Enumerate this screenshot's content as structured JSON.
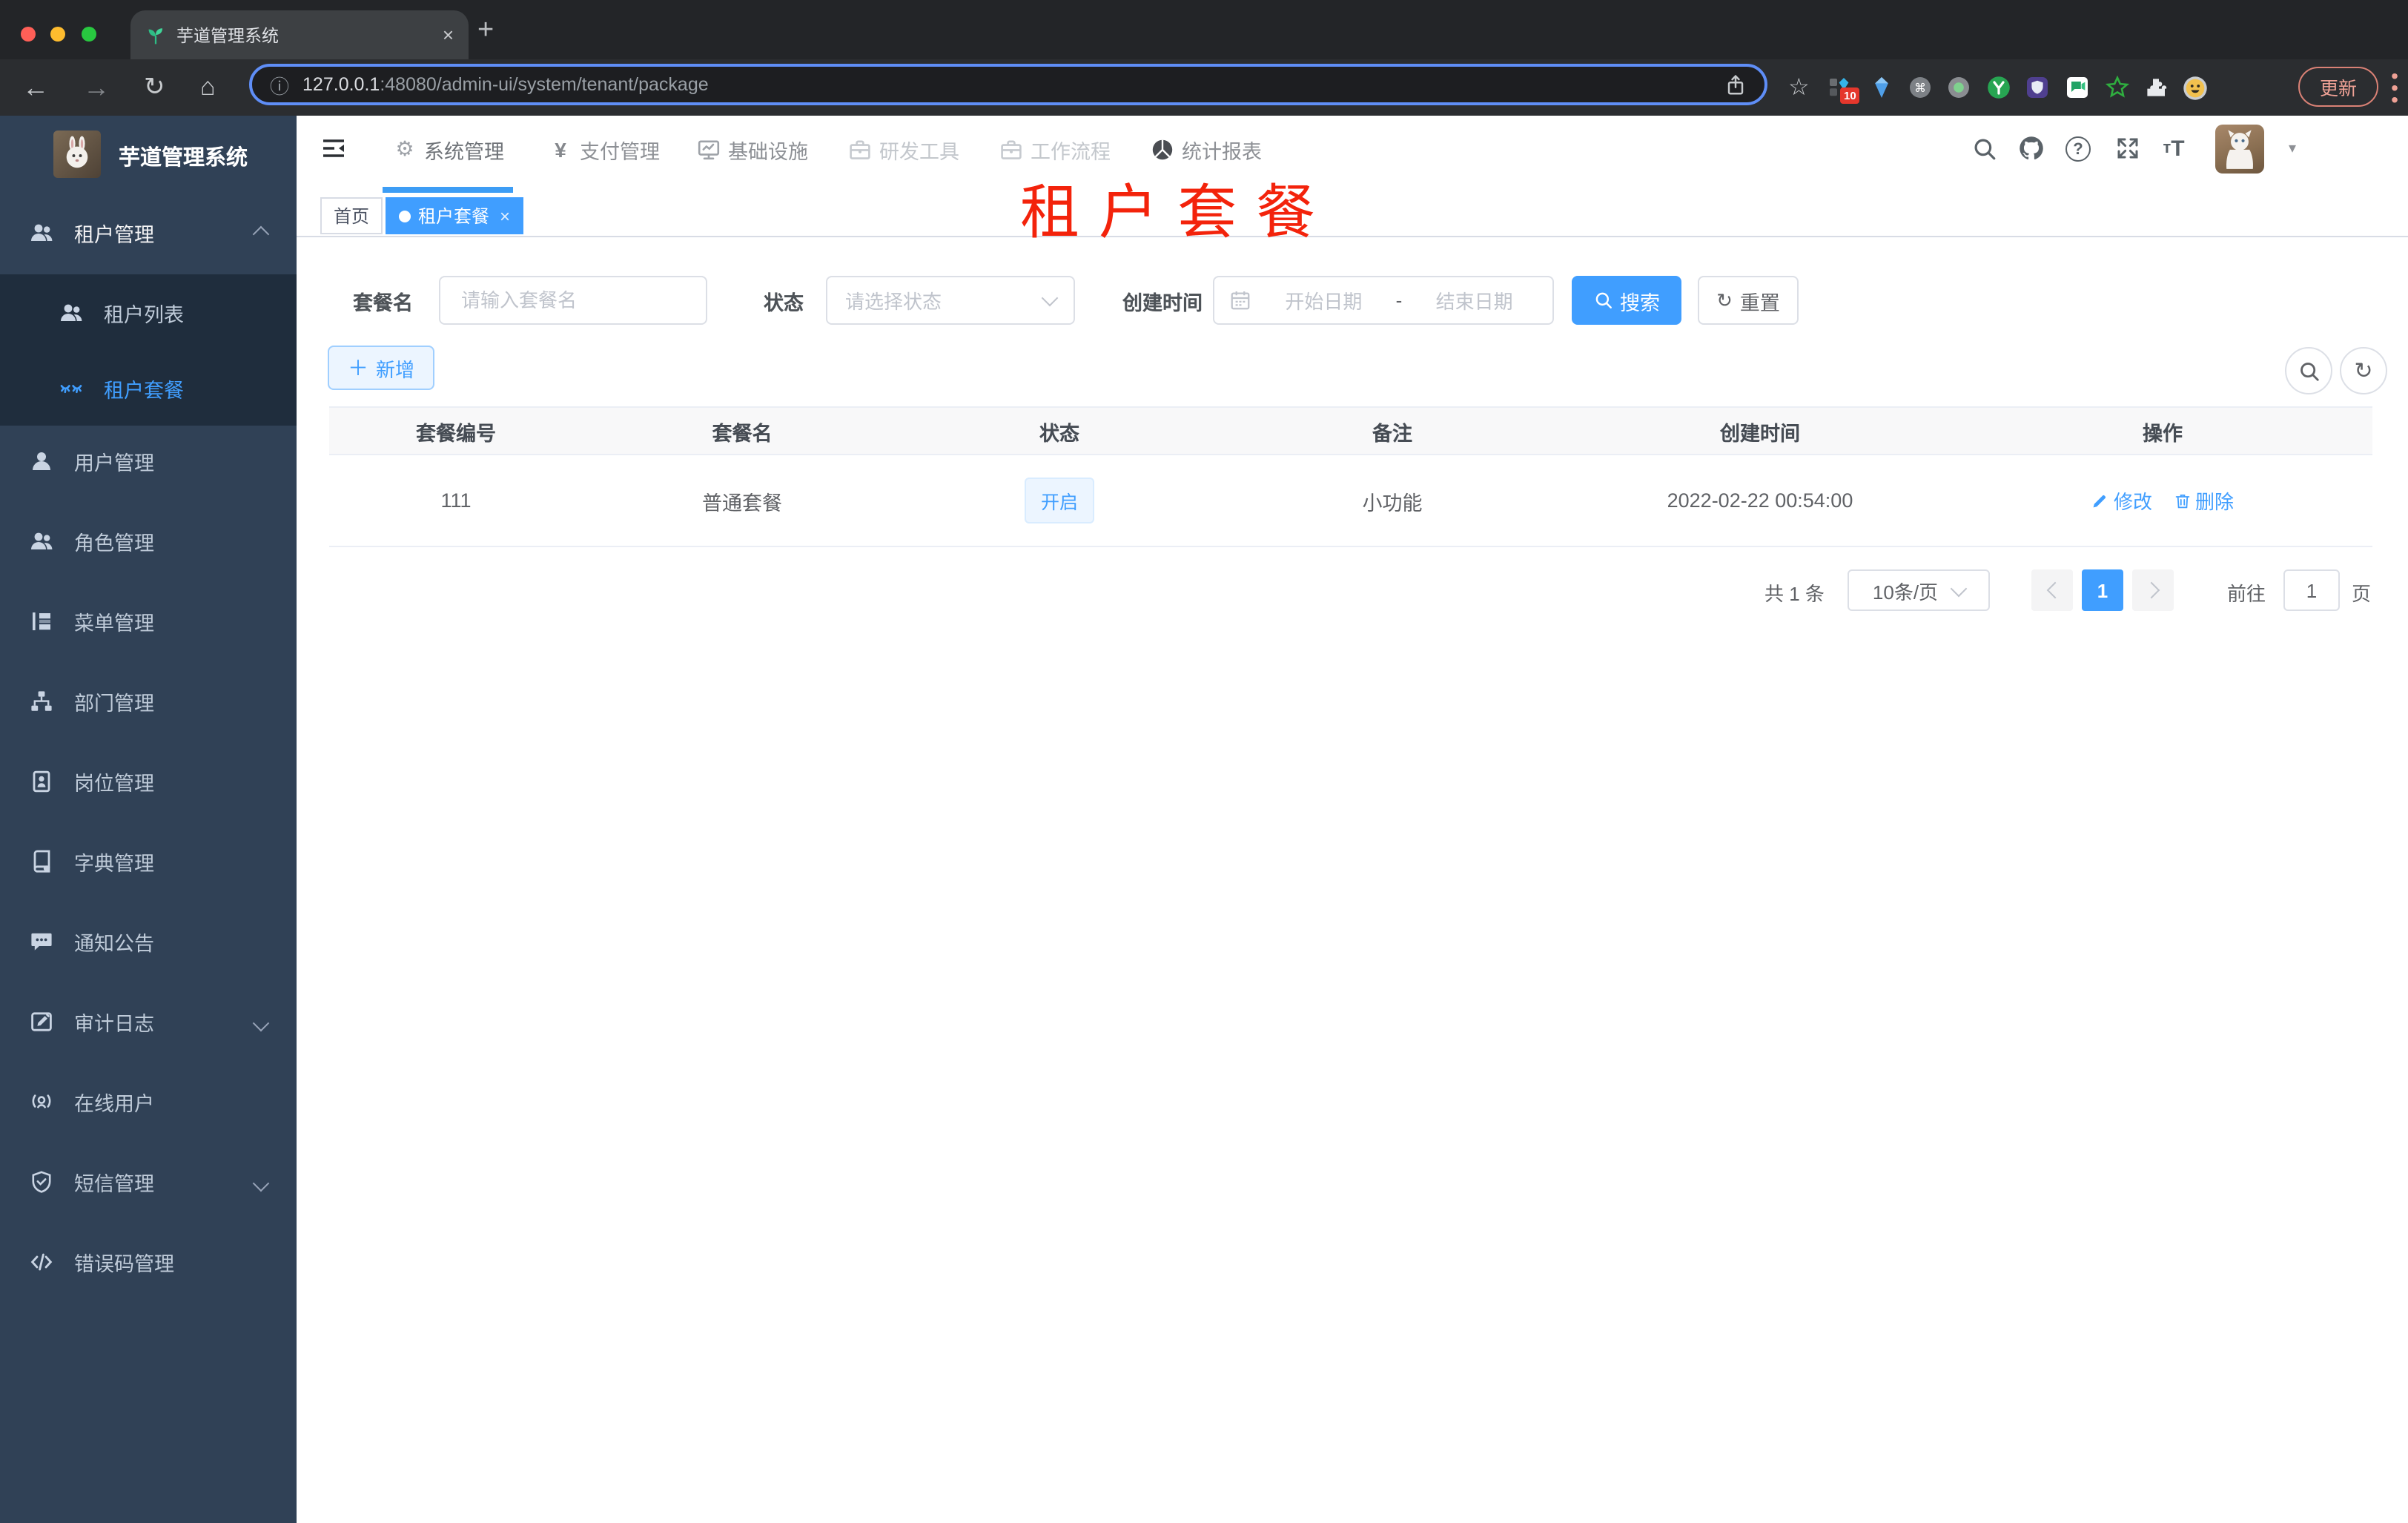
{
  "browser": {
    "tab_title": "芋道管理系统",
    "close_tab": "×",
    "new_tab": "+",
    "url": {
      "host": "127.0.0.1",
      "path": ":48080/admin-ui/system/tenant/package"
    },
    "extensions_badge": "10",
    "update_label": "更新"
  },
  "sidebar": {
    "app_title": "芋道管理系统",
    "items": [
      {
        "label": "租户管理"
      },
      {
        "label": "租户列表"
      },
      {
        "label": "租户套餐"
      },
      {
        "label": "用户管理"
      },
      {
        "label": "角色管理"
      },
      {
        "label": "菜单管理"
      },
      {
        "label": "部门管理"
      },
      {
        "label": "岗位管理"
      },
      {
        "label": "字典管理"
      },
      {
        "label": "通知公告"
      },
      {
        "label": "审计日志"
      },
      {
        "label": "在线用户"
      },
      {
        "label": "短信管理"
      },
      {
        "label": "错误码管理"
      }
    ]
  },
  "topnav": {
    "items": [
      {
        "label": "系统管理"
      },
      {
        "label": "支付管理"
      },
      {
        "label": "基础设施"
      },
      {
        "label": "研发工具"
      },
      {
        "label": "工作流程"
      },
      {
        "label": "统计报表"
      }
    ]
  },
  "tags": {
    "home": "首页",
    "active": "租户套餐"
  },
  "overlay_title": "租户套餐",
  "filters": {
    "name_label": "套餐名",
    "name_placeholder": "请输入套餐名",
    "status_label": "状态",
    "status_placeholder": "请选择状态",
    "created_label": "创建时间",
    "date_start_placeholder": "开始日期",
    "date_separator": "-",
    "date_end_placeholder": "结束日期",
    "search_label": "搜索",
    "reset_label": "重置",
    "add_label": "新增"
  },
  "table": {
    "columns": [
      "套餐编号",
      "套餐名",
      "状态",
      "备注",
      "创建时间",
      "操作"
    ],
    "row": {
      "id": "111",
      "name": "普通套餐",
      "status": "开启",
      "remark": "小功能",
      "created_at": "2022-02-22 00:54:00",
      "edit_label": "修改",
      "delete_label": "删除"
    }
  },
  "pagination": {
    "total": "共 1 条",
    "page_size": "10条/页",
    "current_page": "1",
    "goto_label": "前往",
    "goto_value": "1",
    "page_unit": "页"
  },
  "colors": {
    "primary": "#409EFF",
    "sidebar_bg": "#304156",
    "submenu_bg": "#1F2D3D",
    "overlay_title": "#F3230B",
    "status_tag_bg": "#ECF5FF"
  }
}
